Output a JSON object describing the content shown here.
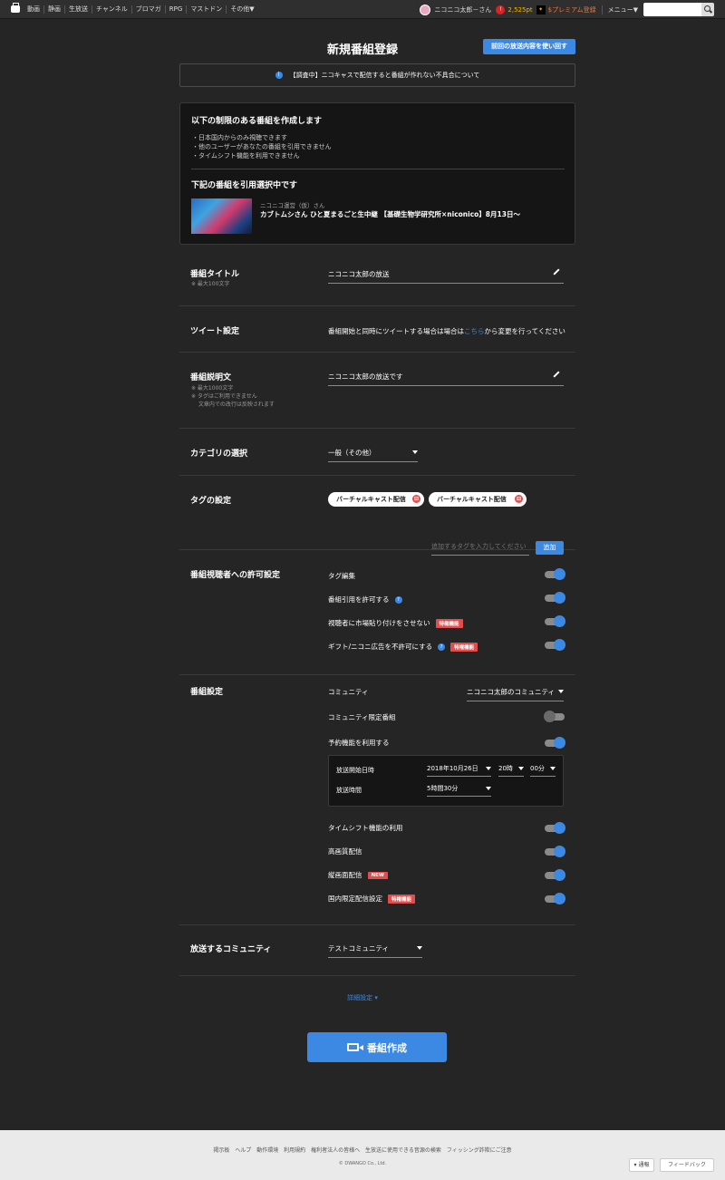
{
  "nav": {
    "items": [
      "動画",
      "静画",
      "生放送",
      "チャンネル",
      "ブロマガ",
      "RPG",
      "マストドン",
      "その他▼"
    ],
    "user_name": "ニコニコ太郎－さん",
    "points": "2,525pt",
    "premium": "$プレミアム登録",
    "menu": "メニュー▼"
  },
  "page": {
    "title": "新規番組登録",
    "reuse_button": "前回の放送内容を使い回す",
    "notice": "【調査中】ニコキャスで配信すると番組が作れない不具合について"
  },
  "restriction": {
    "heading": "以下の制限のある番組を作成します",
    "items": [
      "・日本国内からのみ視聴できます",
      "・他のユーザーがあなたの番組を引用できません",
      "・タイムシフト機能を利用できません"
    ],
    "quote_heading": "下記の番組を引用選択中です",
    "quote_channel": "ニコニコ運営（仮）さん",
    "quote_title": "カブトムシさん ひと夏まるごと生中継 【基礎生物学研究所×niconico】8月13日～"
  },
  "form": {
    "title_label": "番組タイトル",
    "title_note": "※ 最大100文字",
    "title_value": "ニコニコ太郎の放送",
    "tweet_label": "ツイート設定",
    "tweet_text_before": "番組開始と同時にツイートする場合は場合は",
    "tweet_link": "こちら",
    "tweet_text_after": "から変更を行ってください",
    "desc_label": "番組説明文",
    "desc_notes": [
      "※ 最大1000文字",
      "※ タグはご利用できません",
      "　 文章内での改行は反映されます"
    ],
    "desc_value": "ニコニコ太郎の放送です",
    "category_label": "カテゴリの選択",
    "category_value": "一般（その他）",
    "tag_label": "タグの設定",
    "tags": [
      "バーチャルキャスト配信",
      "バーチャルキャスト配信"
    ],
    "tag_input_placeholder": "追加するタグを入力してください",
    "tag_add": "追加",
    "permission_label": "番組視聴者への許可設定",
    "permissions": [
      {
        "label": "タグ編集",
        "on": true
      },
      {
        "label": "番組引用を許可する",
        "on": true,
        "info": "?"
      },
      {
        "label": "視聴者に市場貼り付けをさせない",
        "on": true,
        "badge": "特権機能"
      },
      {
        "label": "ギフト/ニコニ広告を不許可にする",
        "on": true,
        "info": "?",
        "badge": "特権機能"
      }
    ],
    "program_label": "番組設定",
    "community_label": "コミュニティ",
    "community_value": "ニコニコ太郎のコミュニティ",
    "community_limited": "コミュニティ限定番組",
    "community_limited_on": false,
    "reserve": "予約機能を利用する",
    "reserve_on": true,
    "start_label": "放送開始日時",
    "start_date": "2018年10月26日",
    "start_hour": "20時",
    "start_min": "00分",
    "duration_label": "放送時間",
    "duration_value": "5時間30分",
    "options": [
      {
        "label": "タイムシフト機能の利用",
        "on": true
      },
      {
        "label": "高画質配信",
        "on": true
      },
      {
        "label": "縦画面配信",
        "on": true,
        "badge": "NEW"
      },
      {
        "label": "国内限定配信設定",
        "on": true,
        "badge": "特権機能"
      }
    ],
    "broadcast_comm_label": "放送するコミュニティ",
    "broadcast_comm_value": "テストコミュニティ"
  },
  "details": "詳細設定 ▾",
  "create_button": "番組作成",
  "footer": {
    "links": [
      "掲示板",
      "ヘルプ",
      "動作環境",
      "利用規約",
      "権利者法人の皆様へ",
      "生放送に使用できる音源の検索",
      "フィッシング詐欺にご注意"
    ],
    "copyright": "© DWANGO Co., Ltd.",
    "report": "▾ 通報",
    "feedback": "フィードバック"
  }
}
